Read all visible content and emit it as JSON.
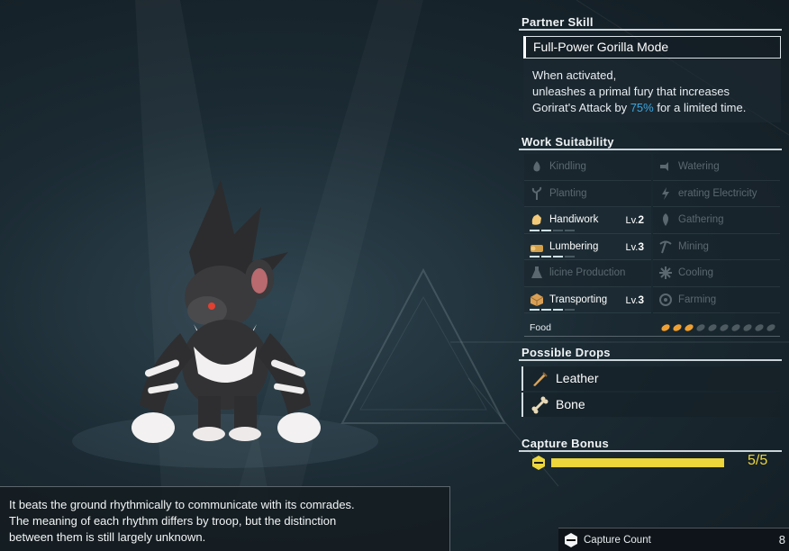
{
  "partner_skill": {
    "heading": "Partner Skill",
    "name": "Full-Power Gorilla Mode",
    "desc_line1": "When activated,",
    "desc_line2": "unleashes a primal fury that increases",
    "desc_line3a": "Gorirat's Attack by ",
    "desc_highlight": "75%",
    "desc_line3b": " for a limited time."
  },
  "work": {
    "heading": "Work Suitability",
    "cells": [
      {
        "label": "Kindling",
        "icon": "flame-icon",
        "level": ""
      },
      {
        "label": "Watering",
        "icon": "water-icon",
        "level": ""
      },
      {
        "label": "Planting",
        "icon": "sprout-icon",
        "level": ""
      },
      {
        "label": "erating Electricity",
        "icon": "electricity-icon",
        "level": ""
      },
      {
        "label": "Handiwork",
        "icon": "hand-icon",
        "level": "2"
      },
      {
        "label": "Gathering",
        "icon": "leaf-icon",
        "level": ""
      },
      {
        "label": "Lumbering",
        "icon": "log-icon",
        "level": "3"
      },
      {
        "label": "Mining",
        "icon": "pickaxe-icon",
        "level": ""
      },
      {
        "label": "licine Production",
        "icon": "flask-icon",
        "level": ""
      },
      {
        "label": "Cooling",
        "icon": "snowflake-icon",
        "level": ""
      },
      {
        "label": "Transporting",
        "icon": "box-icon",
        "level": "3"
      },
      {
        "label": "Farming",
        "icon": "farm-icon",
        "level": ""
      }
    ],
    "lv_prefix": "Lv.",
    "food_label": "Food",
    "food_filled": 3,
    "food_total": 10
  },
  "drops": {
    "heading": "Possible Drops",
    "items": [
      {
        "label": "Leather",
        "icon": "leather-icon"
      },
      {
        "label": "Bone",
        "icon": "bone-icon"
      }
    ]
  },
  "capture": {
    "heading": "Capture Bonus",
    "value_text": "5/5",
    "fill_fraction": 1.0,
    "count_label": "Capture Count",
    "count_value": "8"
  },
  "description": {
    "line1": "It beats the ground rhythmically to communicate with its comrades.",
    "line2": "The meaning of each rhythm differs by troop, but the distinction",
    "line3": "between them is still largely unknown."
  },
  "colors": {
    "accent_blue": "#3ba7e0",
    "capture_yellow": "#ecd63c",
    "food_orange": "#f0a030"
  }
}
